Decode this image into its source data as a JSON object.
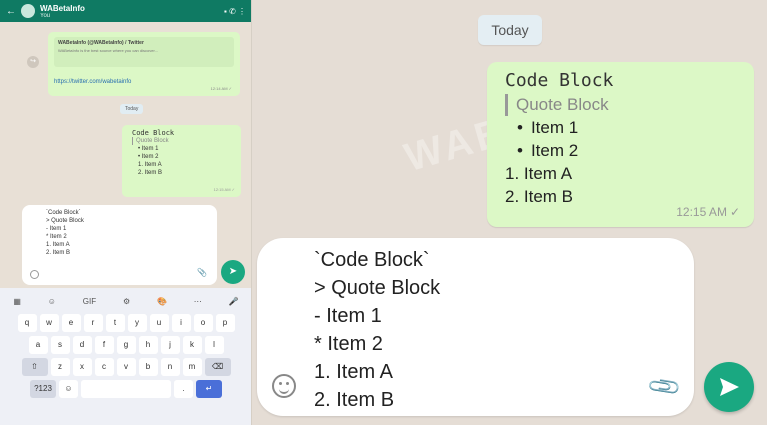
{
  "mini": {
    "header_back": "←",
    "header_title": "WABetaInfo",
    "header_subtitle": "You",
    "header_icons": "▪ ✆ ⋮",
    "link_card_title": "WABetaInfo (@WABetaInfo) / Twitter",
    "link_card_desc": "WABetaInfo is the best source where you can discover...",
    "link_url": "https://twitter.com/wabetainfo",
    "link_time": "12:14 AM ✓",
    "fwd_icon": "↪",
    "today": "Today",
    "bubble": {
      "code": "Code Block",
      "quote": "Quote Block",
      "lines": [
        "• Item 1",
        "• Item 2",
        "1. Item A",
        "2. Item B"
      ],
      "time": "12:15 AM ✓"
    },
    "compose_lines": [
      "`Code Block`",
      "> Quote Block",
      "- Item 1",
      "* Item 2",
      "1. Item A",
      "2. Item B"
    ],
    "send_icon": "➤",
    "clip_icon": "📎",
    "keyboard": {
      "tools": [
        "▦",
        "☺",
        "GIF",
        "⚙",
        "🎨",
        "⋯",
        "🎤"
      ],
      "row1": [
        "q",
        "w",
        "e",
        "r",
        "t",
        "y",
        "u",
        "i",
        "o",
        "p"
      ],
      "row2": [
        "a",
        "s",
        "d",
        "f",
        "g",
        "h",
        "j",
        "k",
        "l"
      ],
      "row3": [
        "⇧",
        "z",
        "x",
        "c",
        "v",
        "b",
        "n",
        "m",
        "⌫"
      ],
      "row4": [
        "?123",
        "☺",
        "",
        ".",
        "↵"
      ]
    }
  },
  "chat": {
    "today": "Today",
    "bubble": {
      "code": "Code Block",
      "quote": "Quote Block",
      "bullets": [
        "Item 1",
        "Item 2"
      ],
      "numbered": [
        "1. Item A",
        "2. Item B"
      ],
      "time": "12:15 AM",
      "tick": "✓"
    },
    "composer_lines": [
      "`Code Block`",
      "> Quote Block",
      "- Item 1",
      "* Item 2",
      "1. Item A",
      "2. Item B"
    ],
    "clip_icon": "📎"
  },
  "watermark": "WABETAINFO",
  "colors": {
    "accent": "#1aa881",
    "bubble_out": "#dcf8c6",
    "background": "#e5ddd5"
  }
}
